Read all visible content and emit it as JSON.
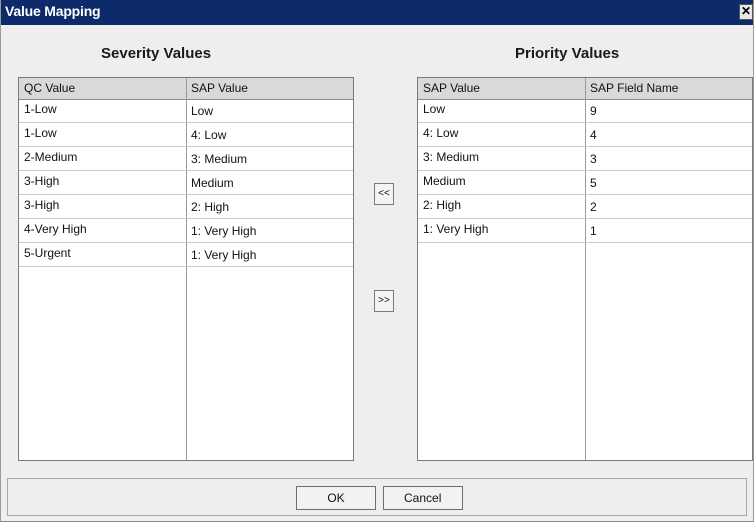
{
  "window": {
    "title": "Value Mapping",
    "close_icon": "close-icon"
  },
  "severity": {
    "title": "Severity Values",
    "columns": [
      "QC Value",
      "SAP Value"
    ],
    "rows": [
      [
        "1-Low",
        "Low"
      ],
      [
        "1-Low",
        "4: Low"
      ],
      [
        "2-Medium",
        "3: Medium"
      ],
      [
        "3-High",
        "Medium"
      ],
      [
        "3-High",
        "2: High"
      ],
      [
        "4-Very High",
        "1: Very High"
      ],
      [
        "5-Urgent",
        "1: Very High"
      ]
    ]
  },
  "priority": {
    "title": "Priority Values",
    "columns": [
      "SAP Value",
      "SAP Field Name"
    ],
    "rows": [
      [
        "Low",
        "9"
      ],
      [
        "4: Low",
        "4"
      ],
      [
        "3: Medium",
        "3"
      ],
      [
        "Medium",
        "5"
      ],
      [
        "2: High",
        "2"
      ],
      [
        "1: Very High",
        "1"
      ]
    ]
  },
  "arrows": {
    "left_label": "<<",
    "right_label": ">>"
  },
  "footer": {
    "ok_label": "OK",
    "cancel_label": "Cancel"
  }
}
